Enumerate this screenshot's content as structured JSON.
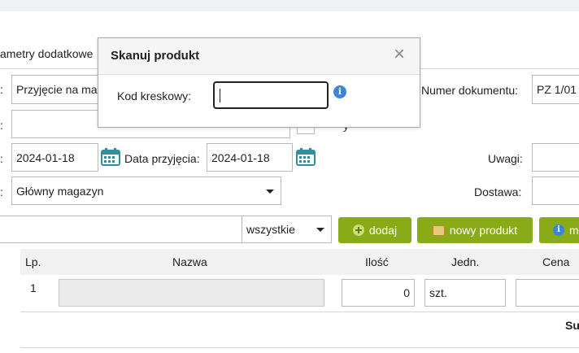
{
  "tab": {
    "label": "ametry dodatkowe"
  },
  "form": {
    "doc_type_value": "Przyjęcie na ma",
    "doc_number_label": "Numer dokumentu:",
    "doc_number_value": "PZ 1/01",
    "contractor_value": "",
    "checkbox_label_fragment": "y",
    "issue_date_value": "2024-01-18",
    "receive_date_label": "Data przyjęcia:",
    "receive_date_value": "2024-01-18",
    "notes_label": "Uwagi:",
    "warehouse_value": "Główny magazyn",
    "delivery_label": "Dostawa:",
    "row_label_suffix": ":"
  },
  "toolbar": {
    "search_value": "",
    "filter_value": "wszystkie",
    "add_label": "dodaj",
    "new_product_label": "nowy produkt",
    "more_label": "m"
  },
  "table": {
    "columns": [
      "Lp.",
      "Nazwa",
      "Ilość",
      "Jedn.",
      "Cena"
    ],
    "rows": [
      {
        "lp": "1",
        "name": "",
        "qty": "0",
        "unit": "szt.",
        "price": ""
      }
    ],
    "summary_fragment": "Su"
  },
  "modal": {
    "title": "Skanuj produkt",
    "close": "×",
    "barcode_label": "Kod kreskowy:",
    "barcode_value": "",
    "info": "i"
  },
  "colors": {
    "button_green": "#8aab18",
    "info_blue": "#3d86d6",
    "calendar_teal": "#2f8f9d"
  }
}
